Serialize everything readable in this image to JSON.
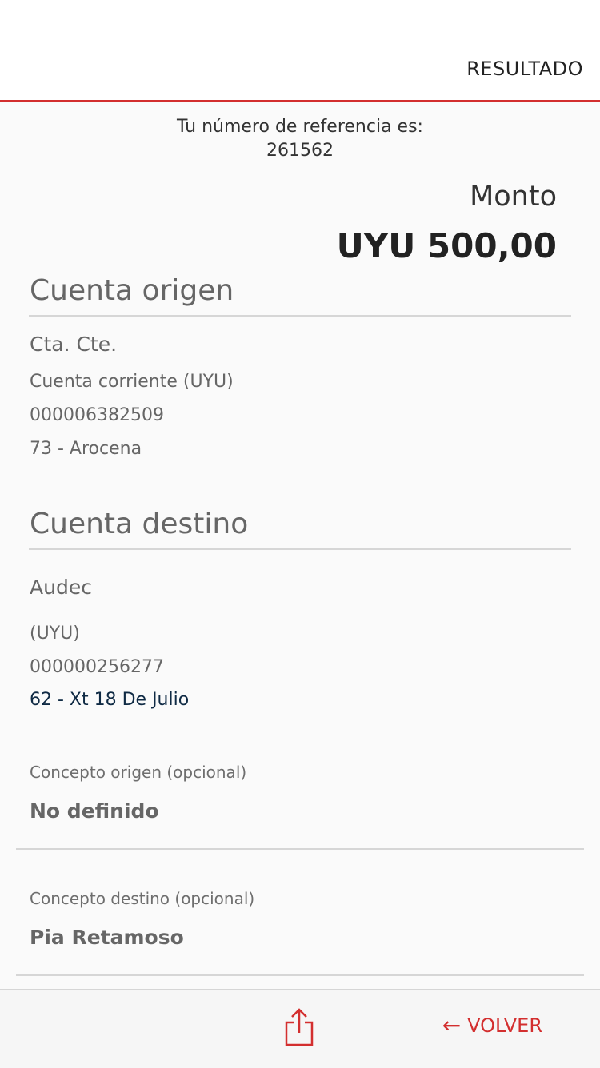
{
  "header": {
    "title": "RESULTADO"
  },
  "reference": {
    "label": "Tu número de referencia es:",
    "number": "261562"
  },
  "amount": {
    "label": "Monto",
    "value": "UYU 500,00"
  },
  "origin_account": {
    "title": "Cuenta origen",
    "type": "Cta. Cte.",
    "description": "Cuenta corriente (UYU)",
    "number": "000006382509",
    "branch": "73 - Arocena"
  },
  "destination_account": {
    "title": "Cuenta destino",
    "name": "Audec",
    "currency": "(UYU)",
    "number": "000000256277",
    "branch": "62 - Xt 18 De Julio"
  },
  "concept_origin": {
    "label": "Concepto origen (opcional)",
    "value": "No definido"
  },
  "concept_destination": {
    "label": "Concepto destino (opcional)",
    "value": "Pia Retamoso"
  },
  "footer": {
    "share_icon": "share-icon",
    "back_arrow": "←",
    "back_label": "VOLVER"
  },
  "colors": {
    "accent": "#d32f2f",
    "background": "#fafafa",
    "text": "#555555"
  }
}
